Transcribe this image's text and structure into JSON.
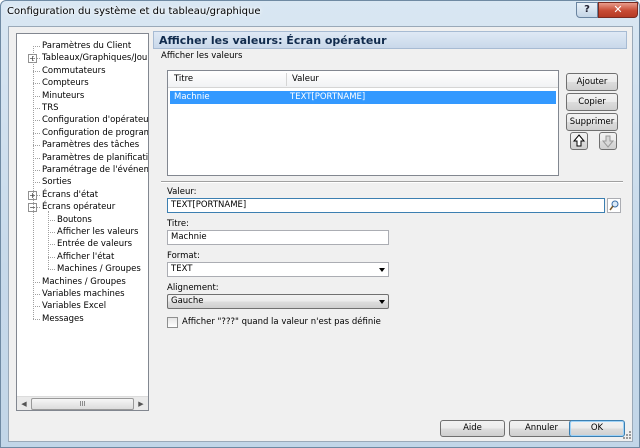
{
  "window": {
    "title": "Configuration du système et du tableau/graphique",
    "help_glyph": "?",
    "close_glyph": "✕"
  },
  "tree": {
    "items": [
      {
        "label": "Paramètres du Client",
        "level": 0
      },
      {
        "label": "Tableaux/Graphiques/Journa",
        "level": 0,
        "expander": "+"
      },
      {
        "label": "Commutateurs",
        "level": 0
      },
      {
        "label": "Compteurs",
        "level": 0
      },
      {
        "label": "Minuteurs",
        "level": 0
      },
      {
        "label": "TRS",
        "level": 0
      },
      {
        "label": "Configuration d'opérateur",
        "level": 0
      },
      {
        "label": "Configuration de programme",
        "level": 0
      },
      {
        "label": "Paramètres des tâches",
        "level": 0
      },
      {
        "label": "Paramètres de planification",
        "level": 0
      },
      {
        "label": "Paramétrage de l'événement",
        "level": 0
      },
      {
        "label": "Sorties",
        "level": 0
      },
      {
        "label": "Écrans d'état",
        "level": 0,
        "expander": "+"
      },
      {
        "label": "Écrans opérateur",
        "level": 0,
        "expander": "−"
      },
      {
        "label": "Boutons",
        "level": 1
      },
      {
        "label": "Afficher les valeurs",
        "level": 1
      },
      {
        "label": "Entrée de valeurs",
        "level": 1
      },
      {
        "label": "Afficher l'état",
        "level": 1
      },
      {
        "label": "Machines / Groupes",
        "level": 1
      },
      {
        "label": "Machines / Groupes",
        "level": 0
      },
      {
        "label": "Variables machines",
        "level": 0
      },
      {
        "label": "Variables Excel",
        "level": 0
      },
      {
        "label": "Messages",
        "level": 0
      }
    ],
    "scroll": {
      "left": "◀",
      "right": "▶",
      "grip": "III"
    }
  },
  "panel": {
    "header": "Afficher les valeurs: Écran opérateur",
    "section": "Afficher les valeurs",
    "list": {
      "columns": [
        "Titre",
        "Valeur"
      ],
      "rows": [
        {
          "titre": "Machnie",
          "valeur": "TEXT[PORTNAME]"
        }
      ]
    },
    "buttons": {
      "add": "Ajouter",
      "copy": "Copier",
      "delete": "Supprimer"
    },
    "value_label": "Valeur:",
    "value": "TEXT[PORTNAME]",
    "title_label": "Titre:",
    "title_value": "Machnie",
    "format_label": "Format:",
    "format_value": "TEXT",
    "align_label": "Alignement:",
    "align_value": "Gauche",
    "checkbox_label": "Afficher \"???\" quand la valeur n'est pas définie"
  },
  "footer": {
    "help": "Aide",
    "cancel": "Annuler",
    "ok": "OK"
  }
}
